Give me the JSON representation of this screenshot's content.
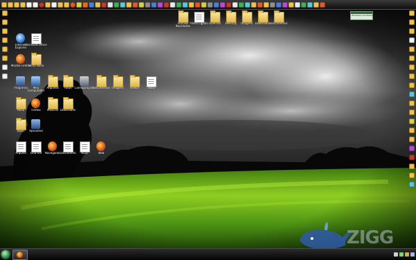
{
  "wallpaper": {
    "scene": "stormy-sky-green-field",
    "colors": {
      "sky_dark": "#1a1a1a",
      "sky_light": "#d9d9d9",
      "grass_bright": "#9fdc2a",
      "grass_dark": "#163b06"
    }
  },
  "top_launcher": {
    "icons": [
      "folder-icon",
      "folder-icon",
      "folder-icon",
      "folder-icon",
      "document-icon",
      "document-icon",
      "orb-icon",
      "folder-icon",
      "document-icon",
      "folder-icon",
      "app-icon",
      "circle-icon",
      "app-icon",
      "firefox-icon",
      "app-icon",
      "folder-icon",
      "app-icon",
      "app-icon",
      "app-icon",
      "app-icon",
      "folder-icon",
      "app-icon",
      "app-icon",
      "app-icon",
      "app-icon",
      "app-icon",
      "app-icon",
      "app-icon",
      "app-icon",
      "app-icon",
      "folder-icon",
      "app-icon",
      "app-icon",
      "app-icon",
      "app-icon",
      "app-icon",
      "app-icon",
      "app-icon",
      "app-icon",
      "app-icon",
      "app-icon",
      "app-icon",
      "folder-icon",
      "app-icon",
      "app-icon",
      "app-icon",
      "folder-icon",
      "app-icon",
      "app-icon",
      "app-icon",
      "app-icon",
      "app-icon"
    ]
  },
  "top_desktop_icons": [
    {
      "type": "folder",
      "label": "Ultimas Novidades"
    },
    {
      "type": "doc",
      "label": "Pasta Ligada"
    },
    {
      "type": "folder",
      "label": "Diversos"
    },
    {
      "type": "folder",
      "label": "Desktop"
    },
    {
      "type": "folder",
      "label": "Imagens"
    },
    {
      "type": "folder",
      "label": "Downloads"
    },
    {
      "type": "folder",
      "label": "Documentos"
    }
  ],
  "mini_window": {
    "title": "Windows Live Messenger"
  },
  "desktop_icons": [
    {
      "type": "app",
      "icon": "ie-icon",
      "label": "Internet Explorer"
    },
    {
      "type": "doc",
      "label": "Microsoft Office"
    },
    {
      "type": "app",
      "icon": "firefox-icon",
      "label": "Mozilla Firefox"
    },
    {
      "type": "folder",
      "label": "Pasta Nova"
    },
    {
      "type": "app",
      "icon": "app-icon",
      "label": "Programa"
    },
    {
      "type": "app",
      "icon": "monitor-icon",
      "label": "Meu Computador"
    },
    {
      "type": "folder",
      "label": "Arquivos"
    },
    {
      "type": "folder",
      "label": "Fotos"
    },
    {
      "type": "app",
      "icon": "gear-icon",
      "label": "Configurações"
    },
    {
      "type": "folder",
      "label": "Documentos"
    },
    {
      "type": "folder",
      "label": "Imagens"
    },
    {
      "type": "folder",
      "label": "Videos"
    },
    {
      "type": "doc",
      "label": "Texto"
    },
    {
      "type": "folder",
      "label": "Pasta"
    },
    {
      "type": "app",
      "icon": "firefox-icon",
      "label": "Firefox"
    },
    {
      "type": "folder",
      "label": "Musicas"
    },
    {
      "type": "folder",
      "label": "Downloads"
    },
    {
      "type": "folder",
      "label": "Jogos"
    },
    {
      "type": "app",
      "icon": "app-icon",
      "label": "Aplicativo"
    },
    {
      "type": "doc",
      "label": "Arquivo"
    },
    {
      "type": "doc",
      "label": "Leia-me"
    },
    {
      "type": "app",
      "icon": "firefox-icon",
      "label": "Navegador"
    },
    {
      "type": "doc",
      "label": "Documento"
    },
    {
      "type": "doc",
      "label": "Nota"
    },
    {
      "type": "app",
      "icon": "firefox-icon",
      "label": "Web"
    }
  ],
  "left_dock": {
    "icons": [
      "folder-icon",
      "folder-icon",
      "folder-icon",
      "folder-icon",
      "folder-icon",
      "folder-icon",
      "document-icon",
      "document-icon"
    ]
  },
  "right_dock": {
    "icons": [
      "app-icon",
      "folder-icon",
      "folder-icon",
      "document-icon",
      "folder-icon",
      "folder-icon",
      "folder-icon",
      "folder-icon",
      "folder-icon",
      "app-icon",
      "folder-icon",
      "folder-icon",
      "app-icon",
      "folder-icon",
      "folder-icon",
      "app-icon",
      "app-icon",
      "folder-icon",
      "folder-icon",
      "app-icon"
    ]
  },
  "taskbar": {
    "start": "start-orb",
    "items": [
      "firefox-icon"
    ],
    "tray_icons": [
      "volume-icon",
      "network-icon",
      "shield-icon",
      "clock-icon"
    ]
  },
  "watermark": {
    "text": "ZIGG",
    "mascot": "whale-icon"
  }
}
